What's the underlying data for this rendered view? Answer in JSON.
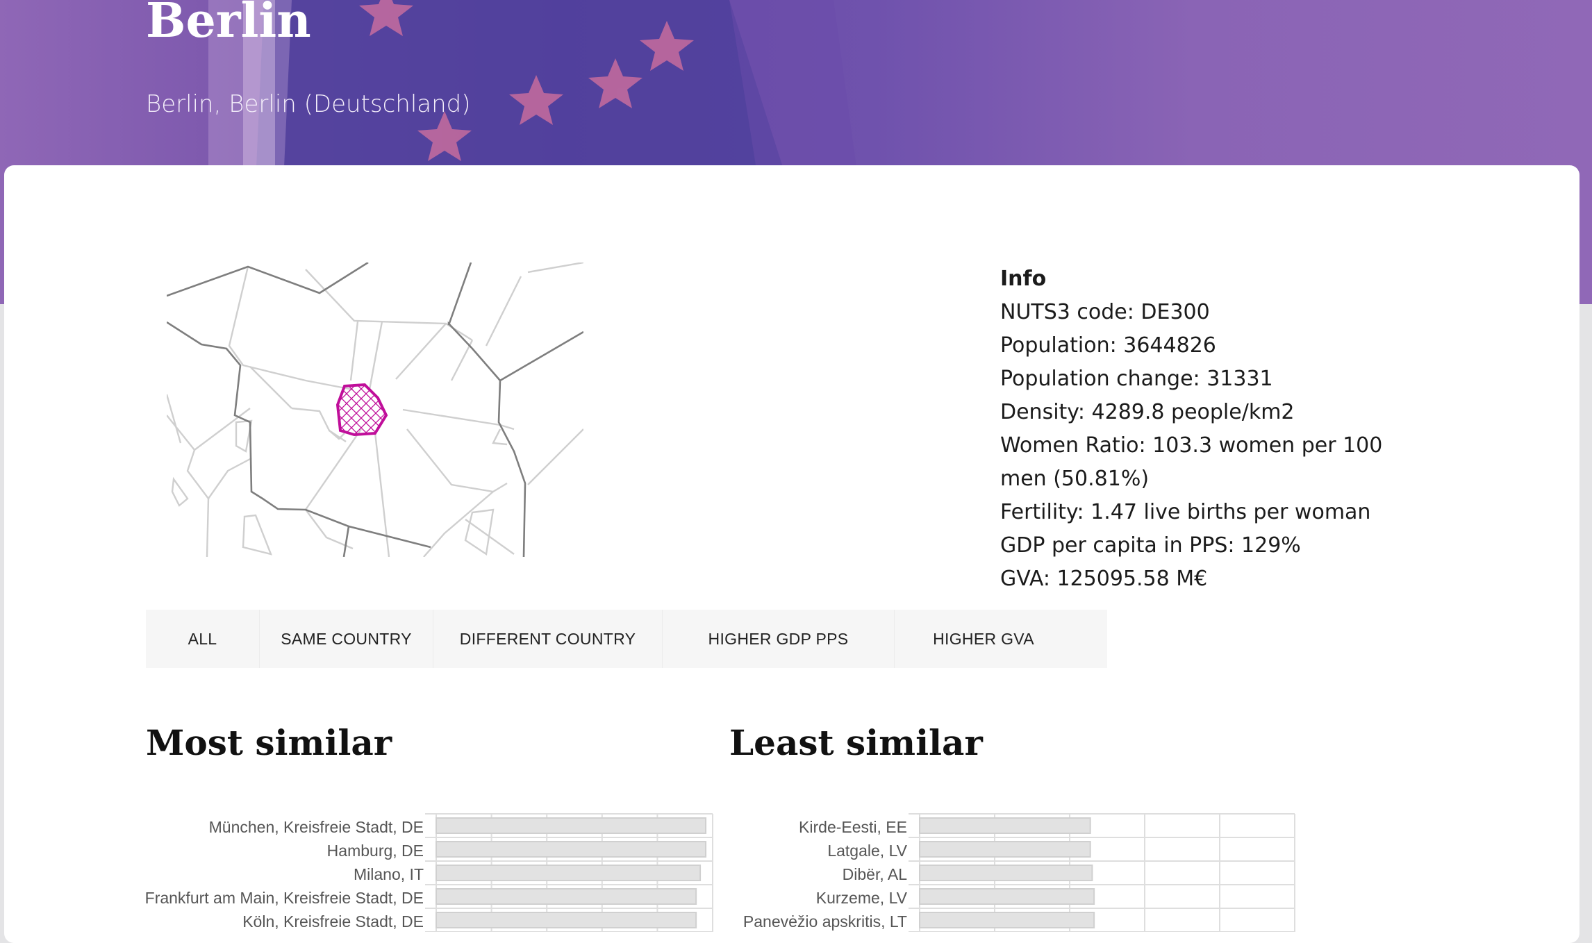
{
  "header": {
    "title": "Berlin",
    "subtitle": "Berlin, Berlin (Deutschland)"
  },
  "map": {
    "highlight_color": "#c00e9a"
  },
  "info": {
    "heading": "Info",
    "nuts3": "NUTS3 code: DE300",
    "population": "Population: 3644826",
    "population_change": "Population change: 31331",
    "density": "Density: 4289.8 people/km2",
    "women_ratio": "Women Ratio: 103.3 women per 100 men (50.81%)",
    "fertility": "Fertility: 1.47 live births per woman",
    "gdp": "GDP per capita in PPS: 129%",
    "gva": "GVA: 125095.58 M€"
  },
  "tabs": [
    {
      "label": "ALL"
    },
    {
      "label": "SAME COUNTRY"
    },
    {
      "label": "DIFFERENT COUNTRY"
    },
    {
      "label": "HIGHER GDP PPS"
    },
    {
      "label": "HIGHER GVA"
    }
  ],
  "most_similar": {
    "title": "Most similar",
    "items": [
      {
        "label": "München, Kreisfreie Stadt, DE",
        "value": 0.975
      },
      {
        "label": "Hamburg, DE",
        "value": 0.975
      },
      {
        "label": "Milano, IT",
        "value": 0.955
      },
      {
        "label": "Frankfurt am Main, Kreisfreie Stadt, DE",
        "value": 0.94
      },
      {
        "label": "Köln, Kreisfreie Stadt, DE",
        "value": 0.94
      }
    ]
  },
  "least_similar": {
    "title": "Least similar",
    "items": [
      {
        "label": "Kirde-Eesti, EE",
        "value": 0.455
      },
      {
        "label": "Latgale, LV",
        "value": 0.455
      },
      {
        "label": "Dibër, AL",
        "value": 0.46
      },
      {
        "label": "Kurzeme, LV",
        "value": 0.465
      },
      {
        "label": "Panevėžio apskritis, LT",
        "value": 0.465
      }
    ]
  }
}
